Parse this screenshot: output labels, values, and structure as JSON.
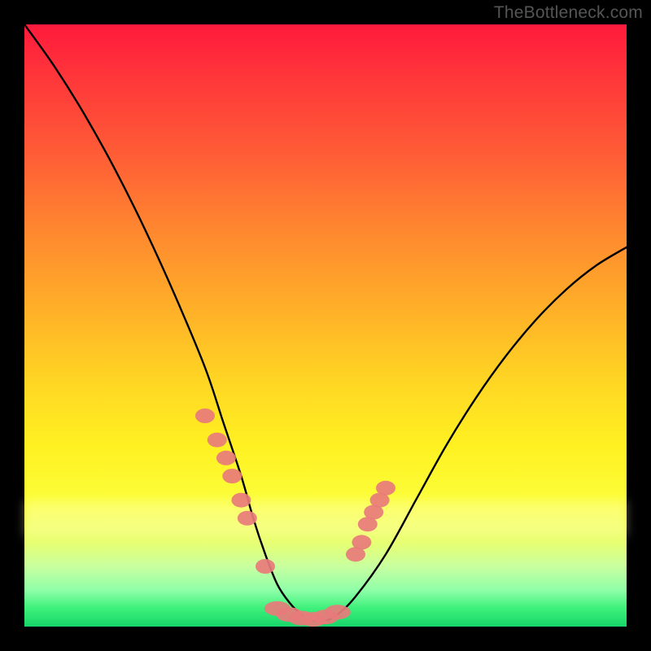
{
  "watermark": "TheBottleneck.com",
  "chart_data": {
    "type": "line",
    "title": "",
    "xlabel": "",
    "ylabel": "",
    "xlim": [
      0,
      100
    ],
    "ylim": [
      0,
      100
    ],
    "series": [
      {
        "name": "bottleneck-curve",
        "x": [
          0,
          5,
          10,
          15,
          20,
          25,
          30,
          33,
          36,
          38,
          40,
          42,
          44,
          46,
          48,
          50,
          52,
          55,
          60,
          65,
          70,
          75,
          80,
          85,
          90,
          95,
          100
        ],
        "y": [
          100,
          93,
          85,
          76,
          66,
          55,
          43,
          34,
          25,
          18,
          12,
          7,
          4,
          2,
          1,
          1,
          2,
          5,
          12,
          21,
          30,
          38,
          45,
          51,
          56,
          60,
          63
        ]
      }
    ],
    "markers": {
      "left_cluster": {
        "x": [
          30,
          32,
          33.5,
          34.5,
          36,
          37,
          40
        ],
        "y": [
          35,
          31,
          28,
          25,
          21,
          18,
          10
        ]
      },
      "right_cluster": {
        "x": [
          55,
          56,
          57,
          58,
          59,
          60
        ],
        "y": [
          12,
          14,
          17,
          19,
          21,
          23
        ]
      },
      "bottom_cluster": {
        "x": [
          42,
          44,
          46,
          48,
          50,
          52
        ],
        "y": [
          3,
          2,
          1.4,
          1.2,
          1.6,
          2.4
        ]
      }
    },
    "gradient_stops": [
      {
        "pos": 0.0,
        "color": "#ff1a3c"
      },
      {
        "pos": 0.35,
        "color": "#ff8a2f"
      },
      {
        "pos": 0.7,
        "color": "#fff122"
      },
      {
        "pos": 0.94,
        "color": "#8effa8"
      },
      {
        "pos": 1.0,
        "color": "#18d66a"
      }
    ]
  }
}
